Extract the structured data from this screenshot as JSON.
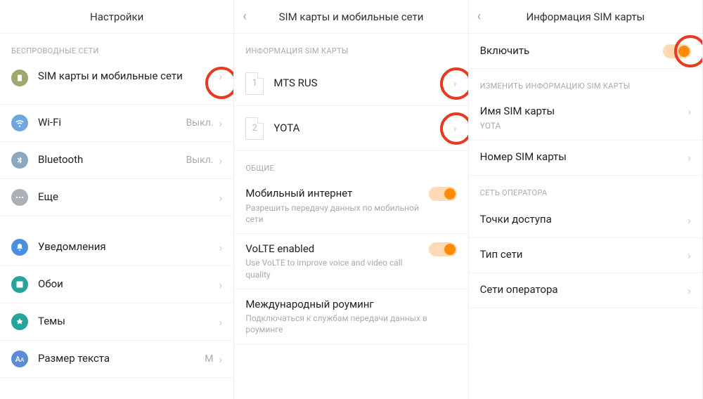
{
  "panel1": {
    "title": "Настройки",
    "section_wireless": "БЕСПРОВОДНЫЕ СЕТИ",
    "sim_label": "SIM карты и мобильные сети",
    "wifi_label": "Wi-Fi",
    "wifi_value": "Выкл.",
    "bt_label": "Bluetooth",
    "bt_value": "Выкл.",
    "more_label": "Еще",
    "notif_label": "Уведомления",
    "wall_label": "Обои",
    "theme_label": "Темы",
    "text_label": "Размер текста",
    "text_value": "М"
  },
  "panel2": {
    "title": "SIM карты и мобильные сети",
    "section_siminfo": "ИНФОРМАЦИЯ SIM КАРТЫ",
    "sim1_num": "1",
    "sim1_label": "MTS RUS",
    "sim2_num": "2",
    "sim2_label": "YOTA",
    "section_general": "ОБЩИЕ",
    "mobile_data_label": "Мобильный интернет",
    "mobile_data_sub": "Разрешить передачу данных по мобильной сети",
    "volte_label": "VoLTE enabled",
    "volte_sub": "Use VoLTE to improve voice and video call quality",
    "roaming_label": "Международный роуминг",
    "roaming_sub": "Подключаться к службам передачи данных в роуминге"
  },
  "panel3": {
    "title": "Информация SIM карты",
    "enable_label": "Включить",
    "section_edit": "ИЗМЕНИТЬ ИНФОРМАЦИЮ SIM КАРТЫ",
    "simname_label": "Имя SIM карты",
    "simname_value": "YOTA",
    "simnum_label": "Номер SIM карты",
    "section_carrier": "СЕТЬ ОПЕРАТОРА",
    "apn_label": "Точки доступа",
    "nettype_label": "Тип сети",
    "carrier_label": "Сети оператора"
  }
}
